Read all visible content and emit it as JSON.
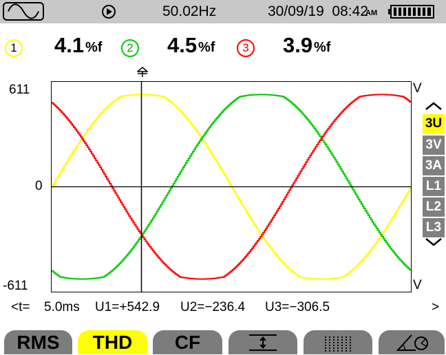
{
  "topbar": {
    "mode_icon": "sine-wave-icon",
    "run_icon": "play-circle-icon",
    "frequency": "50.02Hz",
    "datetime": "30/09/19  08:42",
    "ampm": "AM",
    "battery_icon": "battery-full-icon"
  },
  "phases": [
    {
      "id": "1",
      "value": "4.1",
      "unit": "%f",
      "color": "#ffff00"
    },
    {
      "id": "2",
      "value": "4.5",
      "unit": "%f",
      "color": "#00cc00"
    },
    {
      "id": "3",
      "value": "3.9",
      "unit": "%f",
      "color": "#ff0000"
    }
  ],
  "axis": {
    "y_max_label": "611",
    "y_zero_label": "0",
    "y_min_label": "-611",
    "unit_top": "V",
    "unit_bottom": "V"
  },
  "side_menu": [
    {
      "label": "3U",
      "active": true
    },
    {
      "label": "3V",
      "active": false
    },
    {
      "label": "3A",
      "active": false
    },
    {
      "label": "L1",
      "active": false
    },
    {
      "label": "L2",
      "active": false
    },
    {
      "label": "L3",
      "active": false
    }
  ],
  "readout": {
    "t_label": "<t=",
    "t_value": "5.0ms",
    "u1": "U1=+542.9",
    "u2": "U2=−236.4",
    "u3": "U3=−306.5",
    "next": ">"
  },
  "tabs": [
    {
      "label": "RMS",
      "active": false
    },
    {
      "label": "THD",
      "active": true
    },
    {
      "label": "CF",
      "active": false
    },
    {
      "label": "",
      "icon": "vertical-zoom-icon",
      "active": false
    },
    {
      "label": "",
      "icon": "bars-icon",
      "active": false
    },
    {
      "label": "",
      "icon": "phasor-angle-icon",
      "active": false
    }
  ],
  "chart_data": {
    "type": "line",
    "x_unit": "ms",
    "xlim": [
      0,
      20
    ],
    "ylim": [
      -611,
      611
    ],
    "cursor_x": 5.0,
    "grid": false,
    "series": [
      {
        "color": "#ffff00",
        "amplitude": 565,
        "phase_deg": 0
      },
      {
        "color": "#00cc00",
        "amplitude": 565,
        "phase_deg": -120
      },
      {
        "color": "#ff0000",
        "amplitude": 565,
        "phase_deg": 120
      }
    ]
  }
}
